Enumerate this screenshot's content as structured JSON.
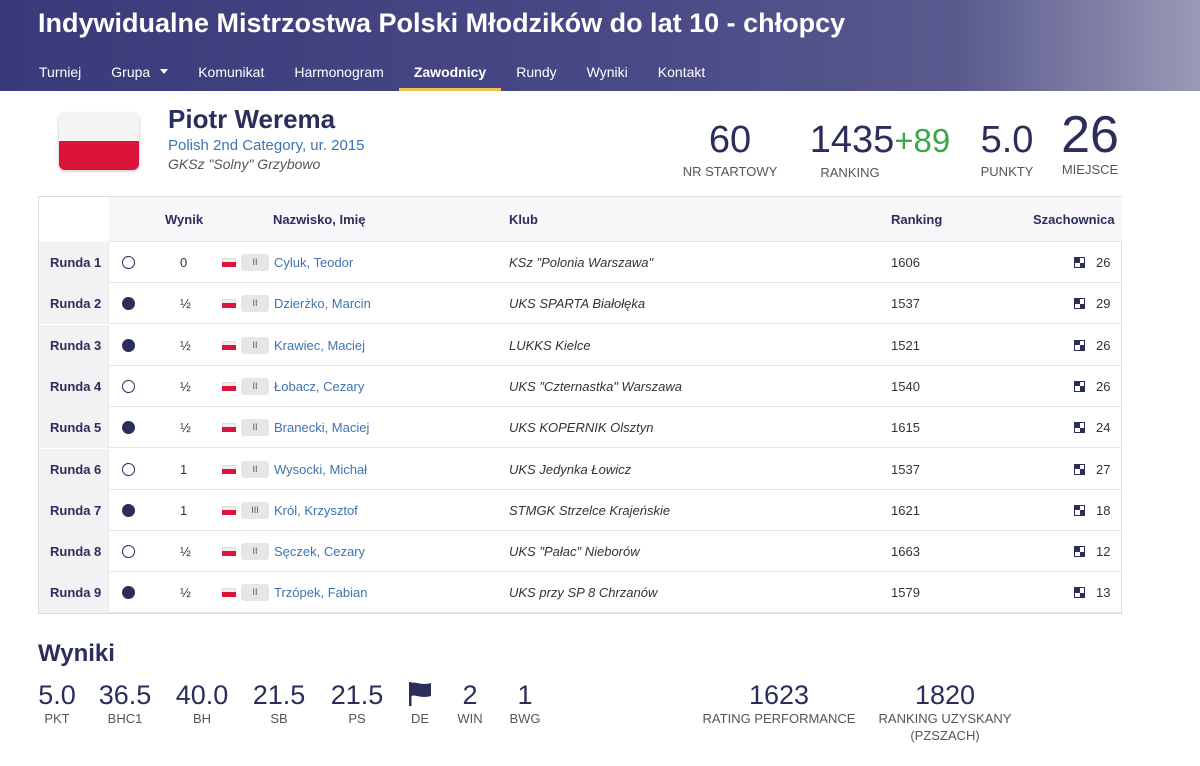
{
  "header": {
    "title": "Indywidualne Mistrzostwa Polski Młodzików do lat 10 - chłopcy",
    "nav": [
      "Turniej",
      "Grupa",
      "Komunikat",
      "Harmonogram",
      "Zawodnicy",
      "Rundy",
      "Wyniki",
      "Kontakt"
    ],
    "active_nav": "Zawodnicy"
  },
  "player": {
    "name": "Piotr Werema",
    "category": "Polish 2nd Category, ur. 2015",
    "club": "GKSz \"Solny\" Grzybowo",
    "flag_colors": [
      "#f4f4f4",
      "#dc143c"
    ]
  },
  "stats": {
    "start_no": "60",
    "start_no_label": "NR STARTOWY",
    "ranking": "1435",
    "ranking_delta": "+89",
    "ranking_label": "RANKING",
    "points": "5.0",
    "points_label": "PUNKTY",
    "place": "26",
    "place_label": "MIEJSCE"
  },
  "table": {
    "headers": {
      "result": "Wynik",
      "name": "Nazwisko, Imię",
      "club": "Klub",
      "ranking": "Ranking",
      "board": "Szachownica"
    },
    "rows": [
      {
        "round": "Runda 1",
        "color": "white",
        "result": "0",
        "cat": "II",
        "name": "Cyluk, Teodor",
        "club": "KSz \"Polonia Warszawa\"",
        "ranking": "1606",
        "board": "26"
      },
      {
        "round": "Runda 2",
        "color": "black",
        "result": "½",
        "cat": "II",
        "name": "Dzierżko, Marcin",
        "club": "UKS SPARTA Białołęka",
        "ranking": "1537",
        "board": "29"
      },
      {
        "round": "Runda 3",
        "color": "black",
        "result": "½",
        "cat": "II",
        "name": "Krawiec, Maciej",
        "club": "LUKKS Kielce",
        "ranking": "1521",
        "board": "26"
      },
      {
        "round": "Runda 4",
        "color": "white",
        "result": "½",
        "cat": "II",
        "name": "Łobacz, Cezary",
        "club": "UKS \"Czternastka\" Warszawa",
        "ranking": "1540",
        "board": "26"
      },
      {
        "round": "Runda 5",
        "color": "black",
        "result": "½",
        "cat": "II",
        "name": "Branecki, Maciej",
        "club": "UKS KOPERNIK Olsztyn",
        "ranking": "1615",
        "board": "24"
      },
      {
        "round": "Runda 6",
        "color": "white",
        "result": "1",
        "cat": "II",
        "name": "Wysocki, Michał",
        "club": "UKS Jedynka Łowicz",
        "ranking": "1537",
        "board": "27"
      },
      {
        "round": "Runda 7",
        "color": "black",
        "result": "1",
        "cat": "III",
        "name": "Król, Krzysztof",
        "club": "STMGK Strzelce Krajeńskie",
        "ranking": "1621",
        "board": "18"
      },
      {
        "round": "Runda 8",
        "color": "white",
        "result": "½",
        "cat": "II",
        "name": "Sęczek, Cezary",
        "club": "UKS \"Pałac\" Nieborów",
        "ranking": "1663",
        "board": "12"
      },
      {
        "round": "Runda 9",
        "color": "black",
        "result": "½",
        "cat": "II",
        "name": "Trzópek, Fabian",
        "club": "UKS przy SP 8 Chrzanów",
        "ranking": "1579",
        "board": "13"
      }
    ]
  },
  "results": {
    "title": "Wyniki",
    "items": [
      {
        "value": "5.0",
        "label": "PKT"
      },
      {
        "value": "36.5",
        "label": "BHC1"
      },
      {
        "value": "40.0",
        "label": "BH"
      },
      {
        "value": "21.5",
        "label": "SB"
      },
      {
        "value": "21.5",
        "label": "PS"
      },
      {
        "value": "",
        "label": "DE",
        "icon": "flag-icon"
      },
      {
        "value": "2",
        "label": "WIN"
      },
      {
        "value": "1",
        "label": "BWG"
      }
    ],
    "performance": {
      "value": "1623",
      "label": "RATING PERFORMANCE"
    },
    "ranking_gained": {
      "value": "1820",
      "label": "RANKING UZYSKANY",
      "label2": "(PZSZACH)"
    }
  },
  "colors": {
    "primary": "#2b2d5c",
    "link": "#3d74b0",
    "accent": "#f2c14e",
    "positive": "#3aa84a"
  }
}
